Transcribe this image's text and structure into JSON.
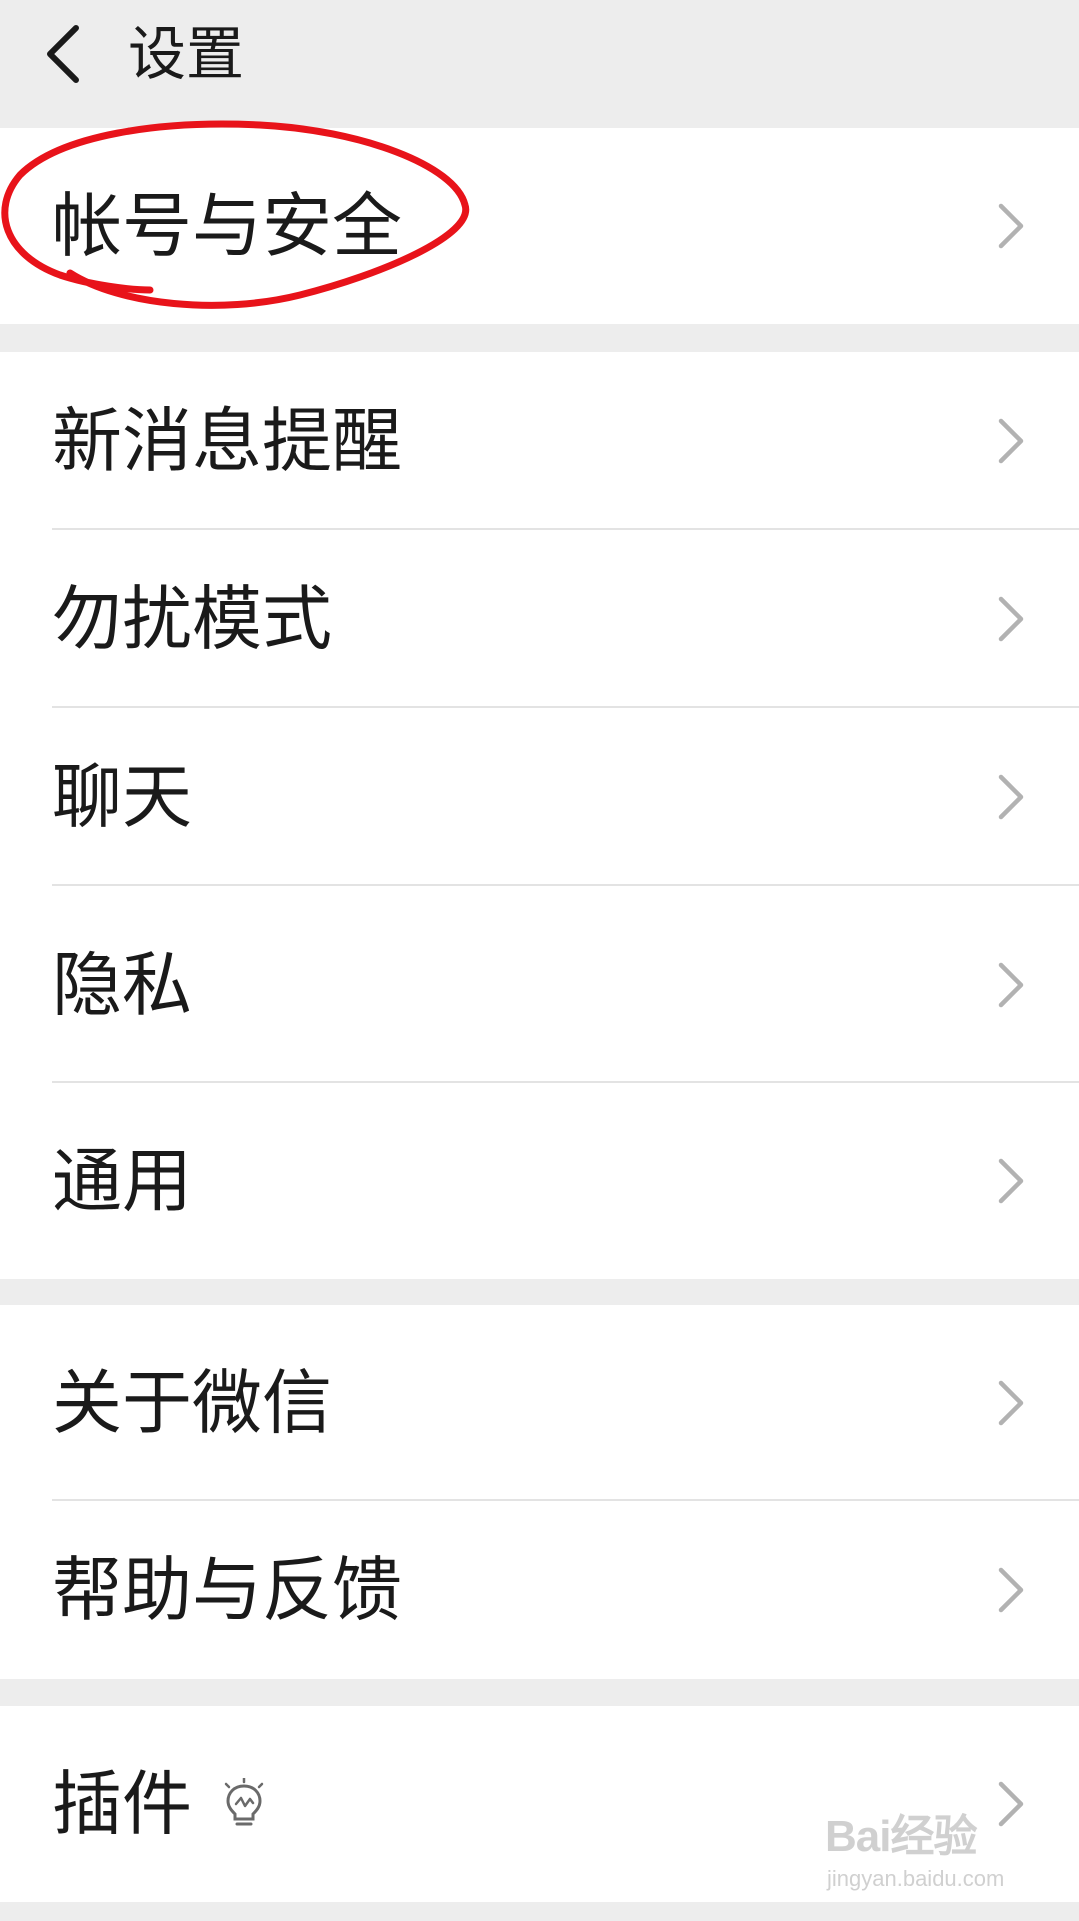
{
  "header": {
    "title": "设置",
    "back_icon": "chevron-left-icon"
  },
  "groups": [
    {
      "items": [
        {
          "label": "帐号与安全"
        }
      ]
    },
    {
      "items": [
        {
          "label": "新消息提醒"
        },
        {
          "label": "勿扰模式"
        },
        {
          "label": "聊天"
        },
        {
          "label": "隐私"
        },
        {
          "label": "通用"
        }
      ]
    },
    {
      "items": [
        {
          "label": "关于微信"
        },
        {
          "label": "帮助与反馈"
        }
      ]
    },
    {
      "items": [
        {
          "label": "插件",
          "badge_icon": "lightbulb-icon"
        }
      ]
    }
  ],
  "annotation": {
    "color": "#e8131a"
  },
  "watermark": {
    "text": "Bai经验",
    "url": "jingyan.baidu.com"
  },
  "colors": {
    "background": "#ededed",
    "row": "#ffffff",
    "text": "#1a1a1a",
    "chevron": "#b2b2b2",
    "divider": "#e3e3e3"
  }
}
